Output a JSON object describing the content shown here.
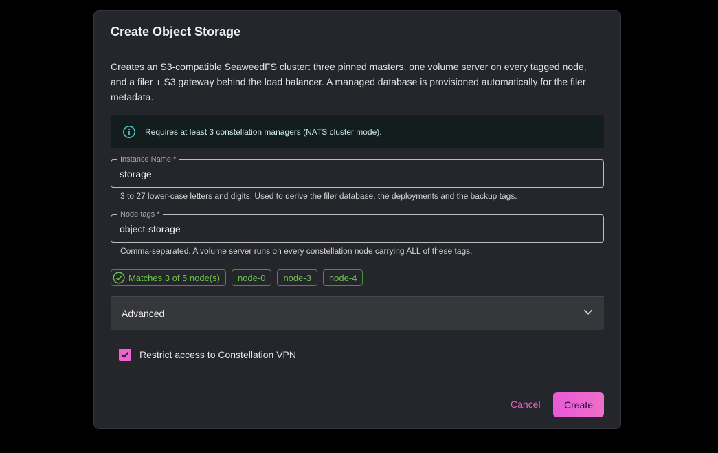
{
  "dialog": {
    "title": "Create Object Storage",
    "description": "Creates an S3-compatible SeaweedFS cluster: three pinned masters, one volume server on every tagged node, and a filer + S3 gateway behind the load balancer. A managed database is provisioned automatically for the filer metadata.",
    "alert": {
      "icon": "info-icon",
      "text": "Requires at least 3 constellation managers (NATS cluster mode)."
    },
    "instance_name": {
      "label": "Instance Name *",
      "value": "storage",
      "helper": "3 to 27 lower-case letters and digits. Used to derive the filer database, the deployments and the backup tags."
    },
    "node_tags": {
      "label": "Node tags *",
      "value": "object-storage",
      "helper": "Comma-separated. A volume server runs on every constellation node carrying ALL of these tags."
    },
    "match_chip": "Matches 3 of 5 node(s)",
    "node_chips": [
      "node-0",
      "node-3",
      "node-4"
    ],
    "advanced_label": "Advanced",
    "vpn_checkbox": {
      "label": "Restrict access to Constellation VPN",
      "checked": true
    },
    "cancel_label": "Cancel",
    "create_label": "Create"
  },
  "colors": {
    "accent": "#f062d0",
    "success": "#6cc24f",
    "info": "#4fc3c8"
  }
}
